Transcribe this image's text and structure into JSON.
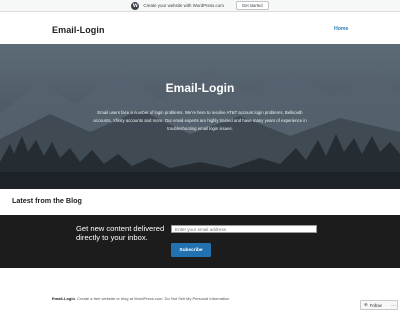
{
  "wpbar": {
    "logo": "W",
    "text": "Create your website with WordPress.com",
    "button": "Get started"
  },
  "header": {
    "site_title": "Email-Login",
    "nav_home": "Home"
  },
  "hero": {
    "title": "Email-Login",
    "description": "Email users face a number of login problems. We’re here to resolve AT&T account login problems, Bellsouth accounts, Xfinity accounts and more. Our email experts are highly trained and have many years of experience in troubleshooting email login issues."
  },
  "blog": {
    "heading": "Latest from the Blog"
  },
  "subscribe": {
    "text": "Get new content delivered directly to your inbox.",
    "placeholder": "Enter your email address",
    "button": "Subscribe"
  },
  "footer": {
    "site": "Email-Login",
    "link1": "Create a free website or blog at WordPress.com.",
    "link2": "Do Not Sell My Personal Information"
  },
  "follow": {
    "icon": "follow-icon",
    "label": "Follow",
    "more": "…"
  },
  "colors": {
    "accent": "#2c7fb8",
    "button": "#2271b1",
    "dark_band": "#1c1c1c",
    "hero_overlay": "#46525e"
  }
}
